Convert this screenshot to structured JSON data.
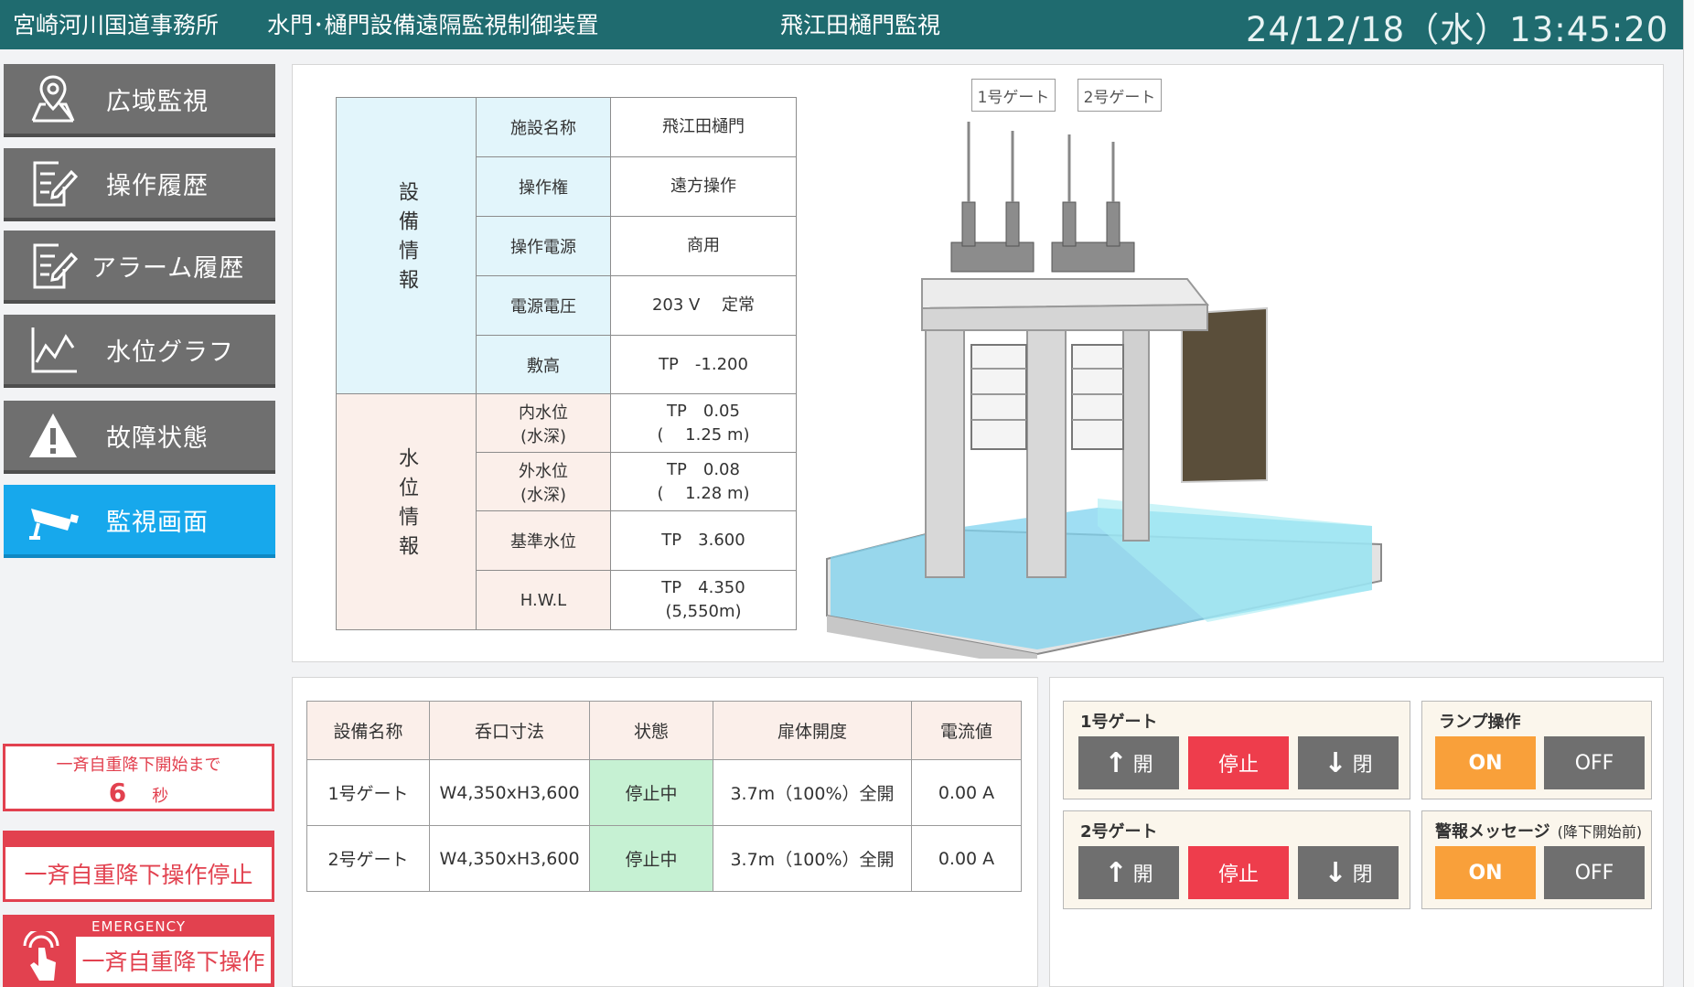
{
  "header": {
    "office": "宮崎河川国道事務所",
    "system": "水門･樋門設備遠隔監視制御装置",
    "screen": "飛江田樋門監視",
    "clock": "24/12/18（水）13:45:20"
  },
  "nav": [
    {
      "label": "広域監視",
      "icon": "map-pin-icon"
    },
    {
      "label": "操作履歴",
      "icon": "edit-document-icon"
    },
    {
      "label": "アラーム履歴",
      "icon": "edit-document-icon"
    },
    {
      "label": "水位グラフ",
      "icon": "line-graph-icon"
    },
    {
      "label": "故障状態",
      "icon": "warning-icon"
    },
    {
      "label": "監視画面",
      "icon": "camera-icon",
      "active": true
    }
  ],
  "auto": {
    "countdown_label": "一斉自重降下開始まで",
    "countdown_value": "6",
    "countdown_unit": "秒",
    "stop_label": "一斉自重降下操作停止",
    "emergency_tag": "EMERGENCY",
    "emergency_label": "一斉自重降下操作"
  },
  "info": {
    "group_equipment": "設備情報",
    "group_water": "水位情報",
    "rows": [
      {
        "key": "施設名称",
        "val": "飛江田樋門"
      },
      {
        "key": "操作権",
        "val": "遠方操作"
      },
      {
        "key": "操作電源",
        "val": "商用"
      },
      {
        "key": "電源電圧",
        "val": "203 V　 定常"
      },
      {
        "key": "敷高",
        "val": "TP　-1.200"
      },
      {
        "key": "内水位",
        "key2": "(水深)",
        "val": "TP　0.05",
        "val2": "(　 1.25 m)"
      },
      {
        "key": "外水位",
        "key2": "(水深)",
        "val": "TP　0.08",
        "val2": "(　 1.28 m)"
      },
      {
        "key": "基準水位",
        "val": "TP　3.600"
      },
      {
        "key": "H.W.L",
        "val": "TP　4.350",
        "val2": "(5,550m)"
      }
    ]
  },
  "gate_tags": [
    "1号ゲート",
    "2号ゲート"
  ],
  "status_table": {
    "headers": [
      "設備名称",
      "呑口寸法",
      "状態",
      "扉体開度",
      "電流値"
    ],
    "rows": [
      [
        "1号ゲート",
        "W4,350xH3,600",
        "停止中",
        "3.7m（100%）全開",
        "0.00 A"
      ],
      [
        "2号ゲート",
        "W4,350xH3,600",
        "停止中",
        "3.7m（100%）全開",
        "0.00 A"
      ]
    ]
  },
  "controls": {
    "gate1_title": "1号ゲート",
    "gate2_title": "2号ゲート",
    "open": "開",
    "stop": "停止",
    "close": "閉",
    "lamp_title": "ランプ操作",
    "alarm_title": "警報メッセージ",
    "alarm_note": "(降下開始前)",
    "on": "ON",
    "off": "OFF"
  }
}
